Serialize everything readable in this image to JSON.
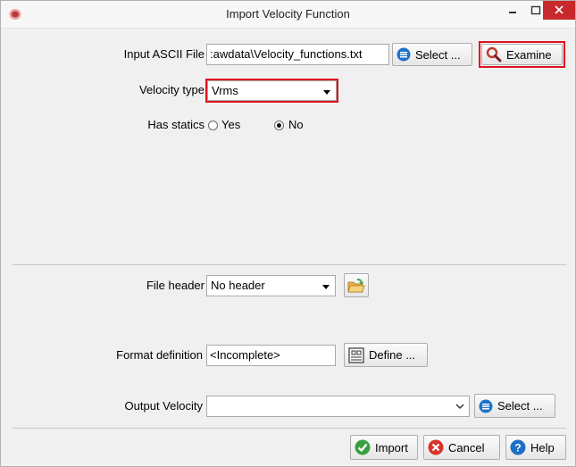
{
  "window": {
    "title": "Import Velocity Function",
    "minimize_label": "–",
    "maximize_label": "□",
    "close_label": "✕"
  },
  "input_file": {
    "label": "Input ASCII File",
    "value": ":awdata\\Velocity_functions.txt",
    "select_label": "Select ...",
    "examine_label": "Examine"
  },
  "velocity_type": {
    "label": "Velocity type",
    "selected": "Vrms"
  },
  "statics": {
    "label": "Has statics",
    "options": [
      {
        "label": "Yes",
        "selected": false
      },
      {
        "label": "No",
        "selected": true
      }
    ]
  },
  "file_header": {
    "label": "File header",
    "selected": "No header"
  },
  "format_definition": {
    "label": "Format definition",
    "value": "<Incomplete>",
    "define_label": "Define ..."
  },
  "output_velocity": {
    "label": "Output Velocity",
    "value": "",
    "select_label": "Select ..."
  },
  "footer": {
    "import_label": "Import",
    "cancel_label": "Cancel",
    "help_label": "Help"
  },
  "icons": {
    "select": "list-icon",
    "examine": "magnifier-icon",
    "open_folder": "folder-open-icon",
    "define": "format-definition-icon",
    "import": "check-icon",
    "cancel": "cancel-icon",
    "help": "help-icon"
  },
  "colors": {
    "highlight_border": "#e0141e",
    "close_button": "#c7292c",
    "select_icon": "#1e73c8",
    "import_icon": "#3aa043",
    "cancel_icon": "#d9342b",
    "help_icon": "#1c6fc4"
  }
}
